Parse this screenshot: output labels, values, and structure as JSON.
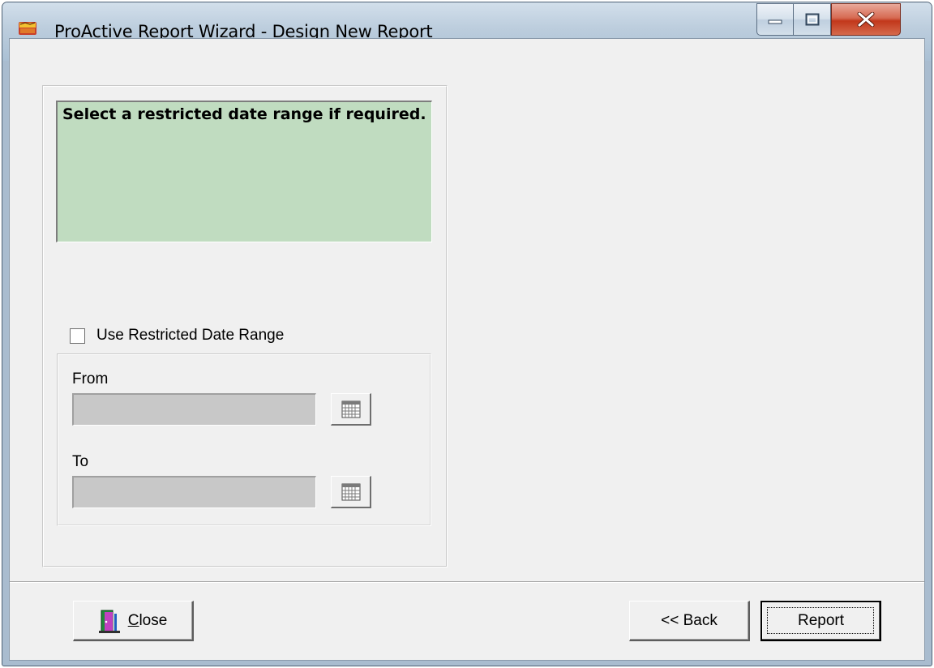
{
  "window": {
    "title": "ProActive Report Wizard - Design New Report"
  },
  "instruction": {
    "text": "Select a restricted date range if required."
  },
  "date_range": {
    "checkbox_label": "Use Restricted Date Range",
    "checked": false,
    "from_label": "From",
    "from_value": "",
    "to_label": "To",
    "to_value": ""
  },
  "buttons": {
    "close_mnemonic": "C",
    "close_rest": "lose",
    "back_label": "<< Back",
    "report_label": "Report"
  },
  "colors": {
    "instruction_bg": "#c0dcc0",
    "disabled_input_bg": "#c8c8c8",
    "dialog_bg": "#f0f0f0"
  }
}
